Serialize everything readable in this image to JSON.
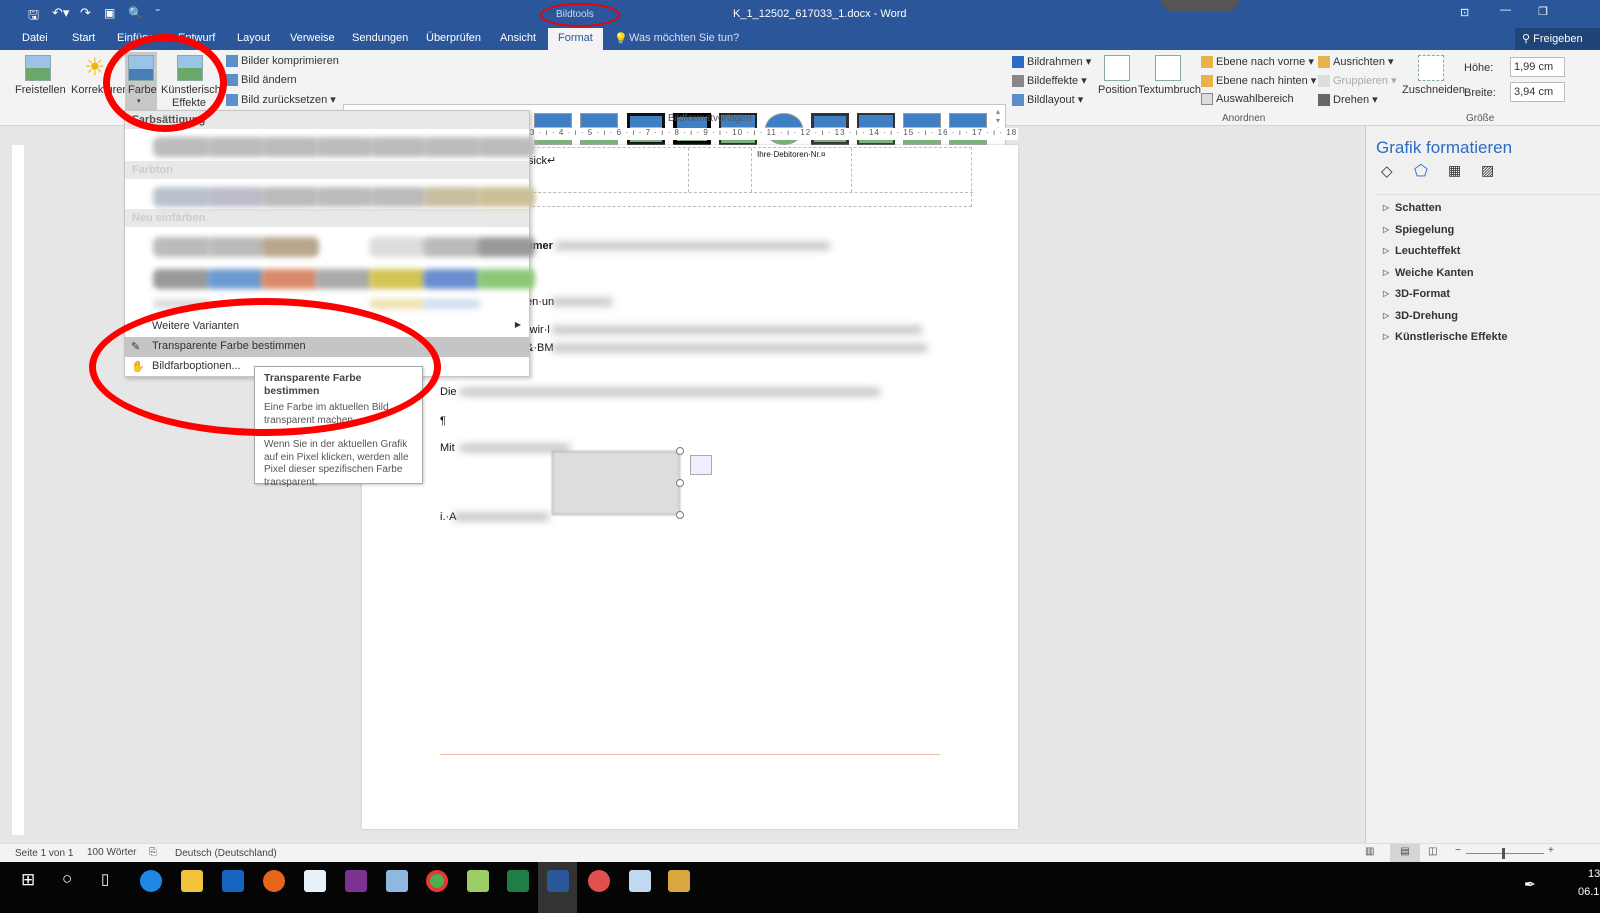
{
  "titlebar": {
    "title": "K_1_12502_617033_1.docx - Word",
    "context_tab": "Bildtools",
    "qat": [
      "save-icon",
      "undo-icon",
      "redo-icon",
      "save-as-icon",
      "print-preview-icon",
      "customize-icon"
    ]
  },
  "tabs": [
    "Datei",
    "Start",
    "Einfügen",
    "Entwurf",
    "Layout",
    "Verweise",
    "Sendungen",
    "Überprüfen",
    "Ansicht",
    "Format"
  ],
  "active_tab": "Format",
  "tell_me": "Was möchten Sie tun?",
  "share": "Freigeben",
  "ribbon": {
    "freistellen": "Freistellen",
    "korrekturen": "Korrekturen",
    "farbe": "Farbe",
    "kuenstlerisch1": "Künstlerische",
    "kuenstlerisch2": "Effekte",
    "komprimieren": "Bilder komprimieren",
    "aendern": "Bild ändern",
    "zuruecksetzen": "Bild zurücksetzen",
    "group_styles": "Bildformatvorlagen",
    "bildrahmen": "Bildrahmen",
    "bildeffekte": "Bildeffekte",
    "bildlayout": "Bildlayout",
    "position": "Position",
    "textumbruch": "Textumbruch",
    "vorne": "Ebene nach vorne",
    "hinten": "Ebene nach hinten",
    "auswahl": "Auswahlbereich",
    "ausrichten": "Ausrichten",
    "gruppieren": "Gruppieren",
    "drehen": "Drehen",
    "group_arrange": "Anordnen",
    "zuschneiden": "Zuschneiden",
    "hoehe_label": "Höhe:",
    "hoehe": "1,99 cm",
    "breite_label": "Breite:",
    "breite": "3,94 cm",
    "group_size": "Größe"
  },
  "ruler": "3 · ı · 4 · ı · 5 · ı · 6 · ı · 7 · ı · 8 · ı · 9 · ı · 10 · ı · 11 · ı · 12 · ı · 13 · ı · 14 · ı · 15 · ı · 16 · ı · 17 · ı · 18",
  "document": {
    "t1": "sick↵",
    "t2": "Ihre·Debitoren·Nr.¤",
    "t3": "umer",
    "t4": "en·un",
    "t5": "·wir·l",
    "t6": "&·BM",
    "t7": "Die",
    "t8": "¶",
    "t9": "Mit",
    "t10": "i.·A"
  },
  "dropdown": {
    "h1": "Farbsättigung",
    "h2": "Farbton",
    "h3": "Neu einfärben",
    "items": [
      "Weitere Varianten",
      "Transparente Farbe bestimmen",
      "Bildfarboptionen..."
    ],
    "highlighted": "Transparente Farbe bestimmen"
  },
  "tooltip": {
    "title": "Transparente Farbe bestimmen",
    "p1": "Eine Farbe im aktuellen Bild transparent machen.",
    "p2": "Wenn Sie in der aktuellen Grafik auf ein Pixel klicken, werden alle Pixel dieser spezifischen Farbe transparent."
  },
  "pane": {
    "title": "Grafik formatieren",
    "icons": [
      "fill-line-icon",
      "effects-icon",
      "layout-size-icon",
      "picture-icon"
    ],
    "items": [
      "Schatten",
      "Spiegelung",
      "Leuchteffekt",
      "Weiche Kanten",
      "3D-Format",
      "3D-Drehung",
      "Künstlerische Effekte"
    ]
  },
  "status": {
    "page": "Seite 1 von 1",
    "words": "100 Wörter",
    "language": "Deutsch (Deutschland)"
  },
  "taskbar": {
    "clock1": "13",
    "clock2": "06.1",
    "apps": [
      "windows",
      "cortana",
      "taskview",
      "ie",
      "explorer",
      "outlook",
      "firefox",
      "app1",
      "onenote",
      "app2",
      "chrome",
      "app3",
      "excel",
      "word",
      "snipping",
      "app4",
      "app5"
    ]
  },
  "colors": {
    "accent": "#2b579a",
    "annotation": "#ff0000"
  }
}
